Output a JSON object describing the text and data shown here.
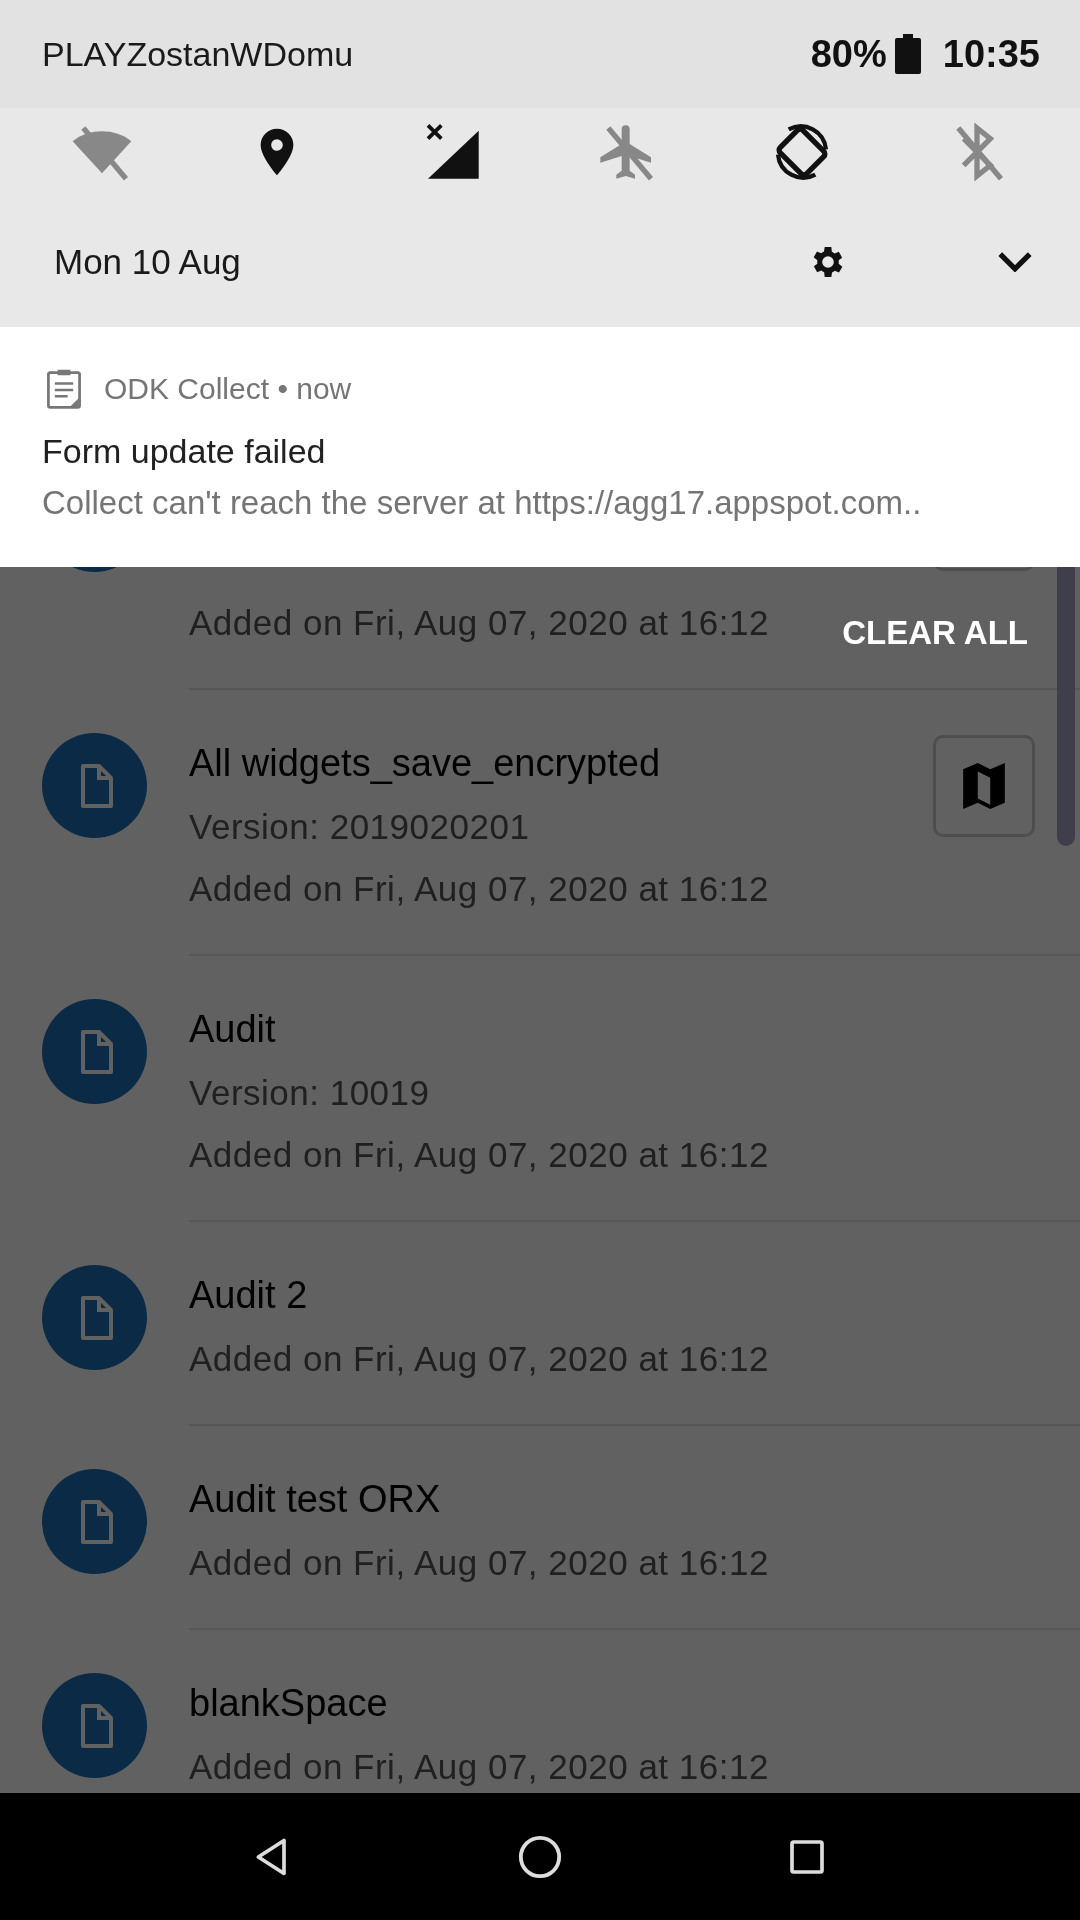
{
  "status_bar": {
    "carrier": "PLAYZostanWDomu",
    "battery": "80%",
    "time": "10:35"
  },
  "quick_settings": {
    "tiles": [
      {
        "kind": "wifi",
        "on": false
      },
      {
        "kind": "location",
        "on": true
      },
      {
        "kind": "mobile_data",
        "on": true
      },
      {
        "kind": "airplane",
        "on": false
      },
      {
        "kind": "auto_rotate",
        "on": true
      },
      {
        "kind": "bluetooth",
        "on": false
      }
    ],
    "date": "Mon 10 Aug"
  },
  "notification": {
    "header": "ODK Collect • now",
    "title": "Form update failed",
    "text": "Collect can't reach the server at https://agg17.appspot.com.."
  },
  "clear_all": "CLEAR ALL",
  "app": {
    "forms": [
      {
        "added": "Added on Fri, Aug 07, 2020 at 16:12",
        "has_map": true
      },
      {
        "name": "All widgets_save_encrypted",
        "version": "Version: 2019020201",
        "added": "Added on Fri, Aug 07, 2020 at 16:12",
        "has_map": true
      },
      {
        "name": "Audit",
        "version": "Version: 10019",
        "added": "Added on Fri, Aug 07, 2020 at 16:12",
        "has_map": false
      },
      {
        "name": "Audit 2",
        "added": "Added on Fri, Aug 07, 2020 at 16:12",
        "has_map": false
      },
      {
        "name": "Audit test ORX",
        "added": "Added on Fri, Aug 07, 2020 at 16:12",
        "has_map": false
      },
      {
        "name": "blankSpace",
        "added": "Added on Fri, Aug 07, 2020 at 16:12",
        "has_map": false
      }
    ]
  }
}
